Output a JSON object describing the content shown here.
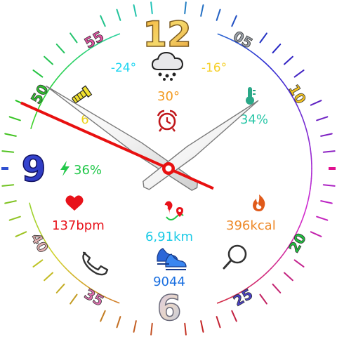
{
  "face": {
    "hour_numerals": {
      "twelve": "12",
      "nine": "9",
      "six": "6"
    },
    "minute_numerals": [
      "05",
      "10",
      "20",
      "25",
      "35",
      "40",
      "50",
      "55"
    ],
    "time": {
      "hour": 10,
      "minute": 8,
      "second": 49
    }
  },
  "weather": {
    "low_temp": "-24°",
    "high_temp": "-16°",
    "current_temp": "30°",
    "icon": "snow-cloud-icon"
  },
  "alarm": {
    "icon": "alarm-clock-icon"
  },
  "humidity": {
    "value": "34%",
    "icon": "thermometer-icon"
  },
  "battery": {
    "value": "36%",
    "icon": "lightning-bolt-icon"
  },
  "uv": {
    "value": "6",
    "icon": "uv-lamp-icon"
  },
  "heart": {
    "value": "137bpm",
    "icon": "heart-icon"
  },
  "calories": {
    "value": "396kcal",
    "icon": "flame-icon"
  },
  "distance": {
    "value": "6,91km",
    "icon": "route-pin-icon"
  },
  "steps": {
    "value": "9044",
    "icon": "sneakers-icon"
  },
  "shortcuts": {
    "phone_icon": "phone-icon",
    "search_icon": "search-icon"
  },
  "colors": {
    "hour_hand": "#ffffff",
    "second_hand": "#e81010",
    "low_temp": "#19d4f0",
    "high_temp": "#f6d02a",
    "current_temp": "#f39a1e",
    "humidity": "#2bc7a8",
    "battery": "#22c84a",
    "uv": "#ecd21c",
    "heart": "#e8121a",
    "calories": "#ee8a2a",
    "distance": "#1ccbe6",
    "steps": "#1a6fe0"
  }
}
